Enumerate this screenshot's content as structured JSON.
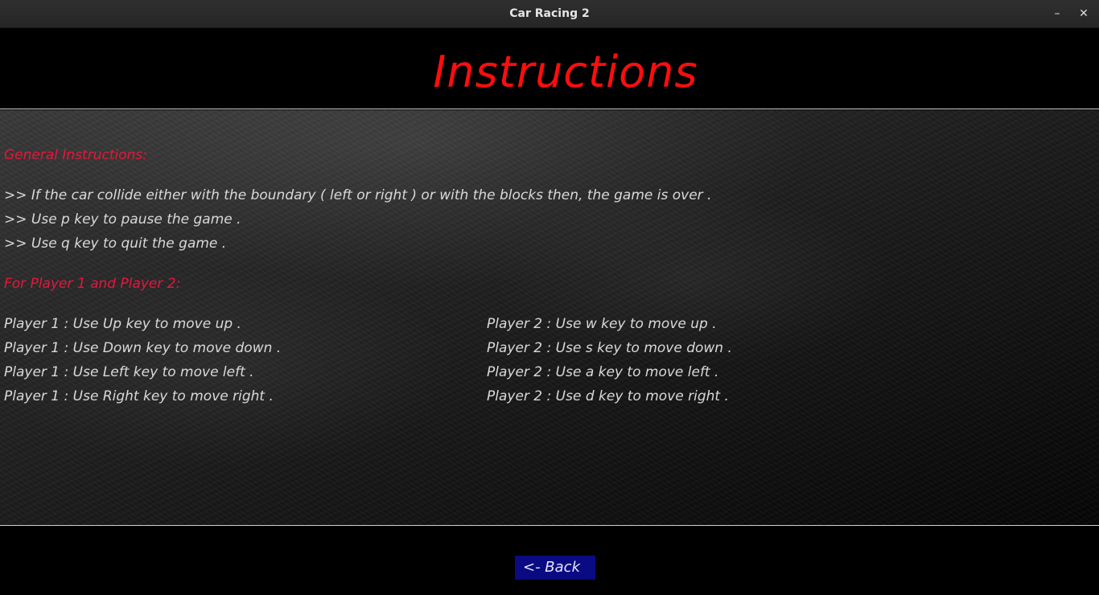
{
  "window": {
    "title": "Car Racing 2",
    "minimize_glyph": "–",
    "close_glyph": "✕"
  },
  "header": {
    "title": "Instructions"
  },
  "general": {
    "heading": "General Instructions:",
    "lines": [
      ">> If the car collide either with the boundary ( left or right ) or with the blocks then, the game is over .",
      ">> Use p key to pause the game .",
      ">> Use q key to quit the game ."
    ]
  },
  "players": {
    "heading": "For Player 1 and Player 2:",
    "player1": [
      "Player 1 : Use Up key to move up .",
      "Player 1 : Use Down key to move down .",
      "Player 1 : Use Left key to move left .",
      "Player 1 : Use Right key to move right ."
    ],
    "player2": [
      "Player 2 : Use w key to move up .",
      "Player 2 : Use s key to move down .",
      "Player 2 : Use a key to move left .",
      "Player 2 : Use d key to move right ."
    ]
  },
  "footer": {
    "back_label": "<- Back"
  },
  "colors": {
    "heading_red": "#ff0d0d",
    "section_red": "#e8163a",
    "body_text": "#d9d9d9",
    "back_button_bg": "#0a0a82"
  }
}
